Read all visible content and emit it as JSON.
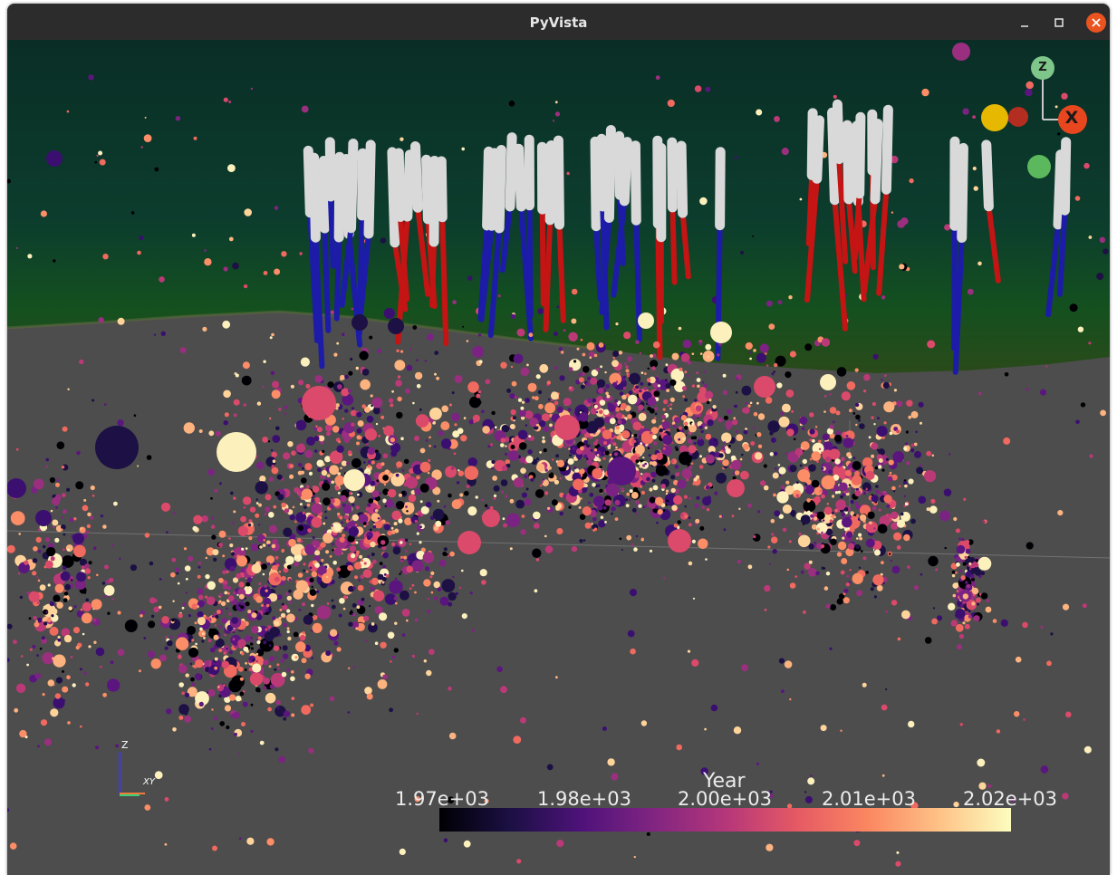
{
  "window": {
    "title": "PyVista",
    "controls": {
      "minimize_icon": "minimize-icon",
      "maximize_icon": "maximize-icon",
      "close_icon": "close-icon",
      "close_color": "#e95420"
    }
  },
  "scene": {
    "background_color": "#4d4d4d",
    "surface_color": "#0b3a2c",
    "well_colors": {
      "upper": "#d9d9d9",
      "lower_a": "#1c1ca8",
      "lower_b": "#c41414"
    }
  },
  "colorbar": {
    "title": "Year",
    "ticks": [
      "1.97e+03",
      "1.98e+03",
      "2.00e+03",
      "2.01e+03",
      "2.02e+03"
    ],
    "colormap": "magma",
    "range": [
      1970,
      2022
    ]
  },
  "orientation_widget": {
    "z_label": "Z",
    "x_label": "X"
  },
  "axes_triad": {
    "z_label": "Z",
    "xy_label": "XY"
  }
}
